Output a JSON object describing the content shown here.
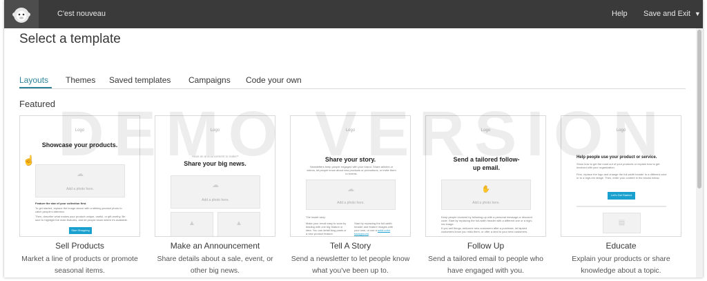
{
  "topbar": {
    "whats_new": "C'est nouveau",
    "help": "Help",
    "save_exit": "Save and Exit",
    "colors": {
      "bar": "#3a3a3a",
      "text": "#e8e8e8"
    }
  },
  "page": {
    "title": "Select a template",
    "featured_heading": "Featured"
  },
  "tabs": [
    {
      "label": "Layouts",
      "active": true
    },
    {
      "label": "Themes",
      "active": false
    },
    {
      "label": "Saved templates",
      "active": false
    },
    {
      "label": "Campaigns",
      "active": false
    },
    {
      "label": "Code your own",
      "active": false
    }
  ],
  "accent_color": "#2c8397",
  "watermark": "DEMO VERSION",
  "cards": [
    {
      "name": "Sell Products",
      "desc": "Market a line of products or promote seasonal items.",
      "preview": {
        "logo": "Logo",
        "headline": "Showcase your products.",
        "photo": "Add a photo here.",
        "subhead": "Feature the star of your collection first.",
        "body": "To get started, replace the image above with a striking product photo to catch people's attention.",
        "body2": "Then, describe what makes your product unique, useful, or gift-worthy. Be sure to highlight the main features, and let people know where it's available.",
        "button": "Start Shopping"
      }
    },
    {
      "name": "Make an Announcement",
      "desc": "Share details about a sale, event, or other big news.",
      "preview": {
        "logo": "Logo",
        "kicker": "Have an announcement to make?",
        "headline": "Share your big news.",
        "photo": "Add a photo here."
      }
    },
    {
      "name": "Tell A Story",
      "desc": "Send a newsletter to let people know what you've been up to.",
      "preview": {
        "logo": "Logo",
        "headline": "Share your story.",
        "body": "Newsletters keep people engaged with your brand. Share articles or videos, let people know about new products or promotions, or invite them to events.",
        "photo": "Add a photo here.",
        "caption": "The inside story",
        "col1": "Make your email easy to scan by leading with one big feature or idea. You can detail blog posts or a new product feature.",
        "col2": "Start by replacing the full-width header and feature images with your own, or use a",
        "link": "solid color background"
      }
    },
    {
      "name": "Follow Up",
      "desc": "Send a tailored email to people who have engaged with you.",
      "preview": {
        "logo": "Logo",
        "headline": "Send a tailored follow-up email.",
        "photo": "Add a photo here.",
        "body": "Keep people involved by following up with a personal message or discount code. Start by replacing the full-width header with a different one or a high-res image.",
        "body2": "If you sell things, welcome new customers after a purchase, let lapsed customers know you miss them, or offer a deal to your best customers."
      }
    },
    {
      "name": "Educate",
      "desc": "Explain your products or share knowledge about a topic.",
      "preview": {
        "logo": "Logo",
        "headline": "Help people use your product or service.",
        "body": "Show how to get the most out of your products or explain how to get involved with your organization.",
        "body2": "First, replace the logo and change the full-width header to a different color or to a high-res image. Then, enter your content in the blocks below.",
        "button": "Let's Get Started"
      }
    }
  ]
}
